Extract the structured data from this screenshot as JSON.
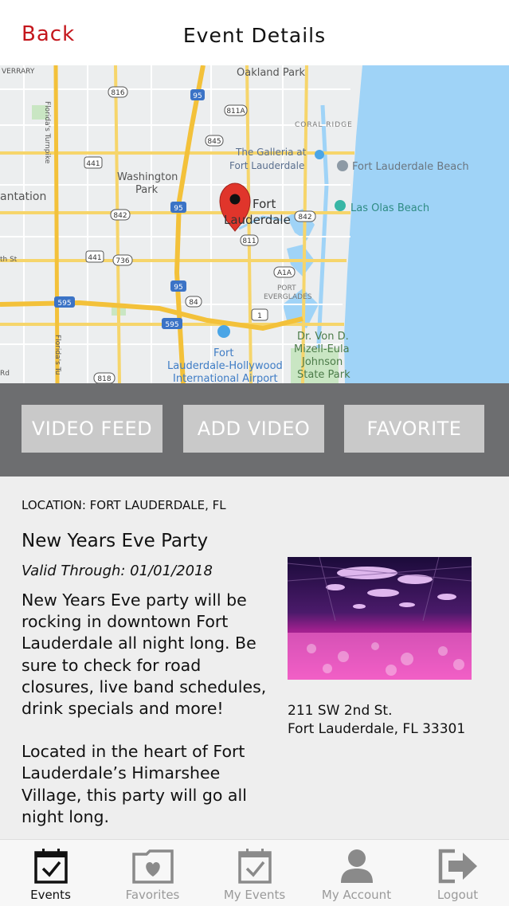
{
  "header": {
    "back_label": "Back",
    "title": "Event Details"
  },
  "map": {
    "labels": {
      "oakland_park": "Oakland Park",
      "coral_ridge": "CORAL RIDGE",
      "galleria": "The Galleria at",
      "galleria2": "Fort Lauderdale",
      "fll_beach": "Fort Lauderdale Beach",
      "washington": "Washington",
      "washington2": "Park",
      "plantation": "antation",
      "fort": "Fort",
      "lauderdale": "Lauderdale",
      "las_olas": "Las Olas Beach",
      "port": "PORT",
      "everglades": "EVERGLADES",
      "von_d1": "Dr. Von D.",
      "von_d2": "Mizell-Eula",
      "von_d3": "Johnson",
      "von_d4": "State Park",
      "airport1": "Fort",
      "airport2": "Lauderdale-Hollywood",
      "airport3": "International Airport",
      "turnpike": "Florida's Turnpike",
      "turnpike2": "Florida's Tu",
      "verrary": "VERRARY",
      "th_st": "th St",
      "rd": "Rd"
    },
    "shields": [
      "816",
      "95",
      "811A",
      "845",
      "441",
      "842",
      "95",
      "811",
      "441",
      "736",
      "A1A",
      "595",
      "84",
      "95",
      "595",
      "1",
      "818",
      "842"
    ]
  },
  "actions": {
    "video_feed": "VIDEO FEED",
    "add_video": "ADD VIDEO",
    "favorite": "FAVORITE"
  },
  "event": {
    "location": "LOCATION: FORT LAUDERDALE, FL",
    "name": "New Years Eve Party",
    "valid_through": "Valid Through: 01/01/2018",
    "desc1": "New Years Eve party will be rocking in downtown Fort Lauderdale all night long.  Be sure to check for road closures, live band schedules, drink specials and more!",
    "desc2": "Located in the heart of Fort Lauderdale’s Himarshee Village, this party will go all night long.",
    "address_line1": "211 SW 2nd St.",
    "address_line2": "Fort Lauderdale, FL 33301"
  },
  "tabs": [
    {
      "label": "Events",
      "icon": "calendar-check-icon",
      "active": true
    },
    {
      "label": "Favorites",
      "icon": "heart-folder-icon",
      "active": false
    },
    {
      "label": "My Events",
      "icon": "calendar-check-icon",
      "active": false
    },
    {
      "label": "My Account",
      "icon": "user-icon",
      "active": false
    },
    {
      "label": "Logout",
      "icon": "logout-arrow-icon",
      "active": false
    }
  ],
  "colors": {
    "accent": "#c4161c",
    "button_bar": "#6d6e70",
    "button": "#c9c9c9",
    "water": "#9fd3f7"
  }
}
